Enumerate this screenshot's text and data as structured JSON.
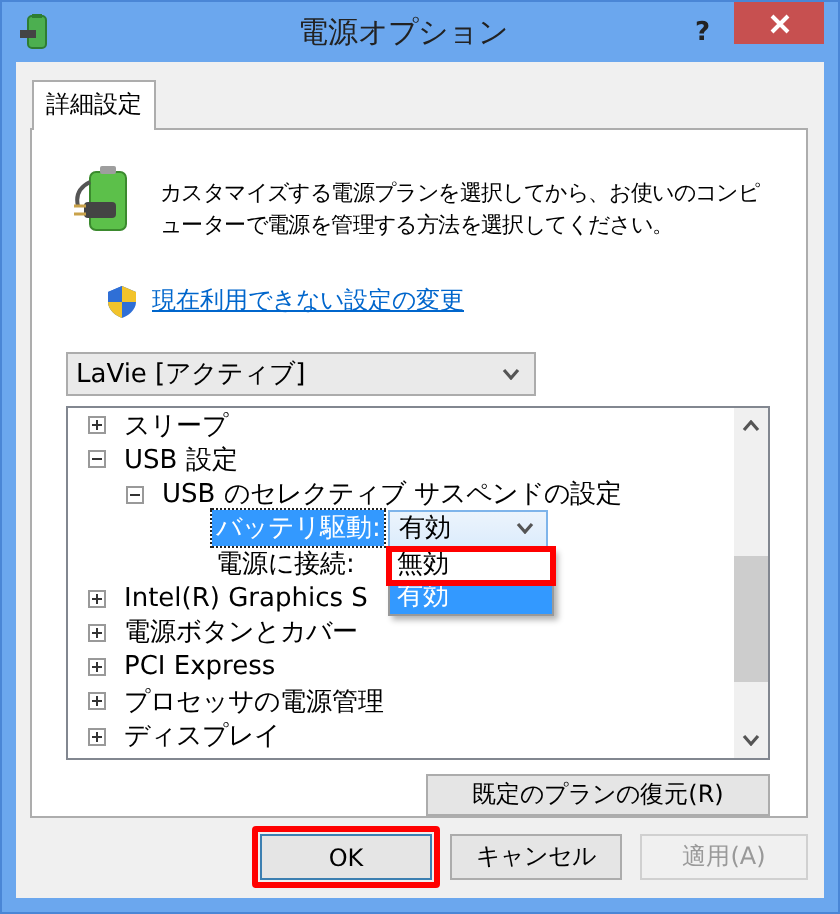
{
  "window": {
    "title": "電源オプション",
    "help": "?"
  },
  "tabs": [
    {
      "label": "詳細設定",
      "selected": true
    }
  ],
  "description": "カスタマイズする電源プランを選択してから、お使いのコンピューターで電源を管理する方法を選択してください。",
  "link": "現在利用できない設定の変更",
  "plan_dropdown": {
    "value": "LaVie [アクティブ]"
  },
  "tree": [
    {
      "kind": "group",
      "label": "スリープ",
      "expanded": false
    },
    {
      "kind": "group",
      "label": "USB 設定",
      "expanded": true,
      "children": [
        {
          "kind": "group",
          "label": "USB のセレクティブ サスペンドの設定",
          "expanded": true,
          "children": [
            {
              "kind": "setting",
              "label": "バッテリ駆動:",
              "selected": true,
              "dropdown": {
                "value": "有効",
                "open": true,
                "options": [
                  {
                    "label": "無効",
                    "selected": false,
                    "highlighted": true
                  },
                  {
                    "label": "有効",
                    "selected": true,
                    "highlighted": false
                  }
                ]
              }
            },
            {
              "kind": "setting",
              "label": "電源に接続:",
              "selected": false
            }
          ]
        }
      ]
    },
    {
      "kind": "group",
      "label": "Intel(R) Graphics S",
      "expanded": false
    },
    {
      "kind": "group",
      "label": "電源ボタンとカバー",
      "expanded": false
    },
    {
      "kind": "group",
      "label": "PCI Express",
      "expanded": false
    },
    {
      "kind": "group",
      "label": "プロセッサの電源管理",
      "expanded": false
    },
    {
      "kind": "group",
      "label": "ディスプレイ",
      "expanded": false
    }
  ],
  "restore_button": {
    "label": "既定のプランの復元(R)"
  },
  "buttons": [
    {
      "label": "OK",
      "default": true,
      "highlighted": true,
      "disabled": false
    },
    {
      "label": "キャンセル",
      "default": false,
      "highlighted": false,
      "disabled": false
    },
    {
      "label": "適用(A)",
      "default": false,
      "highlighted": false,
      "disabled": true
    }
  ]
}
